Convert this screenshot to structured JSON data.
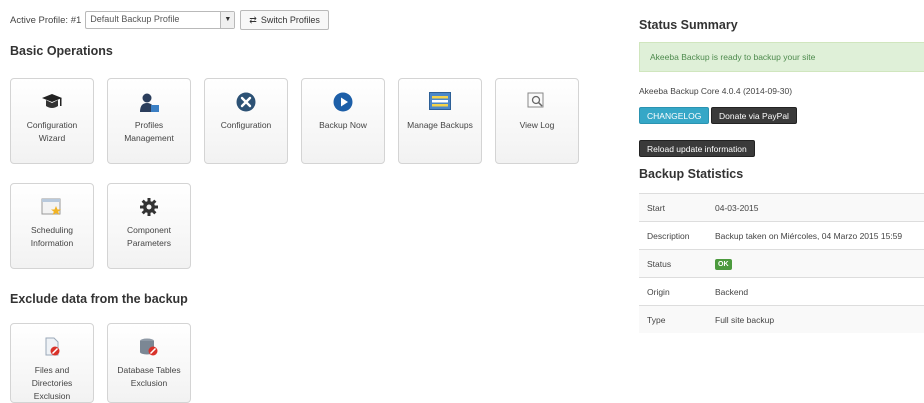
{
  "profile": {
    "label": "Active Profile: #1",
    "selected": "Default Backup Profile",
    "switch_label": "Switch Profiles"
  },
  "basic": {
    "title": "Basic Operations",
    "tiles": [
      {
        "line1": "Configuration",
        "line2": "Wizard",
        "icon": "graduation-cap-icon"
      },
      {
        "line1": "Profiles",
        "line2": "Management",
        "icon": "user-profile-icon"
      },
      {
        "line1": "Configuration",
        "line2": "",
        "icon": "wrench-circle-icon"
      },
      {
        "line1": "Backup Now",
        "line2": "",
        "icon": "play-circle-icon"
      },
      {
        "line1": "Manage Backups",
        "line2": "",
        "icon": "list-box-icon"
      },
      {
        "line1": "View Log",
        "line2": "",
        "icon": "log-search-icon"
      },
      {
        "line1": "Scheduling",
        "line2": "Information",
        "icon": "calendar-star-icon"
      },
      {
        "line1": "Component",
        "line2": "Parameters",
        "icon": "gear-icon"
      }
    ]
  },
  "exclude": {
    "title": "Exclude data from the backup",
    "tiles": [
      {
        "line1": "Files and",
        "line2": "Directories",
        "line3": "Exclusion",
        "icon": "file-block-icon"
      },
      {
        "line1": "Database Tables",
        "line2": "Exclusion",
        "icon": "database-block-icon"
      }
    ]
  },
  "status": {
    "title": "Status Summary",
    "message": "Akeeba Backup is ready to backup your site",
    "version": "Akeeba Backup Core 4.0.4 (2014-09-30)",
    "changelog": "CHANGELOG",
    "donate": "Donate via PayPal",
    "reload": "Reload update information"
  },
  "stats": {
    "title": "Backup Statistics",
    "rows": [
      {
        "key": "Start",
        "value": "04-03-2015"
      },
      {
        "key": "Description",
        "value": "Backup taken on Miércoles, 04 Marzo 2015 15:59"
      },
      {
        "key": "Status",
        "value": "OK"
      },
      {
        "key": "Origin",
        "value": "Backend"
      },
      {
        "key": "Type",
        "value": "Full site backup"
      }
    ]
  },
  "colors": {
    "alert_bg": "#dff0d8",
    "info": "#35a7c7",
    "ok": "#4c9a3e",
    "dark": "#3a3a3a"
  }
}
